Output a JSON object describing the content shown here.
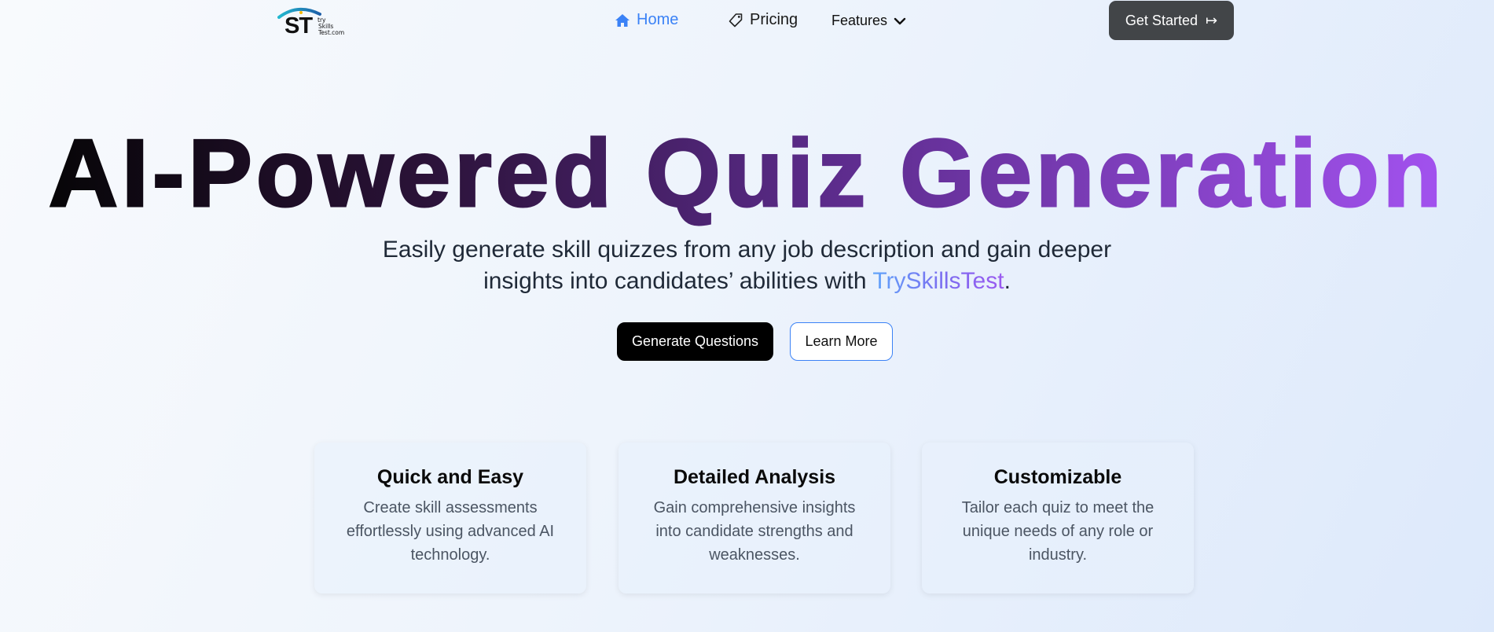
{
  "logo": {
    "mark": "ST",
    "words": [
      "try",
      "Skills",
      "Test.com"
    ]
  },
  "nav": {
    "home": "Home",
    "pricing": "Pricing",
    "features": "Features",
    "cta": "Get Started",
    "cta_arrow": "↦"
  },
  "hero": {
    "title": "AI-Powered Quiz Generation",
    "subtitle_line1": "Easily generate skill quizzes from any job description and gain deeper",
    "subtitle_line2_prefix": "insights into candidates’ abilities with ",
    "subtitle_brand": "TrySkillsTest",
    "subtitle_suffix": ".",
    "primary_button": "Generate Questions",
    "secondary_button": "Learn More"
  },
  "features": [
    {
      "title": "Quick and Easy",
      "text": "Create skill assessments effortlessly using advanced AI technology."
    },
    {
      "title": "Detailed Analysis",
      "text": "Gain comprehensive insights into candidate strengths and weaknesses."
    },
    {
      "title": "Customizable",
      "text": "Tailor each quiz to meet the unique needs of any role or industry."
    }
  ],
  "colors": {
    "accent": "#3b82f6",
    "title_gradient_start": "#050505",
    "title_gradient_end": "#a855f7",
    "cta_background": "#424548"
  }
}
